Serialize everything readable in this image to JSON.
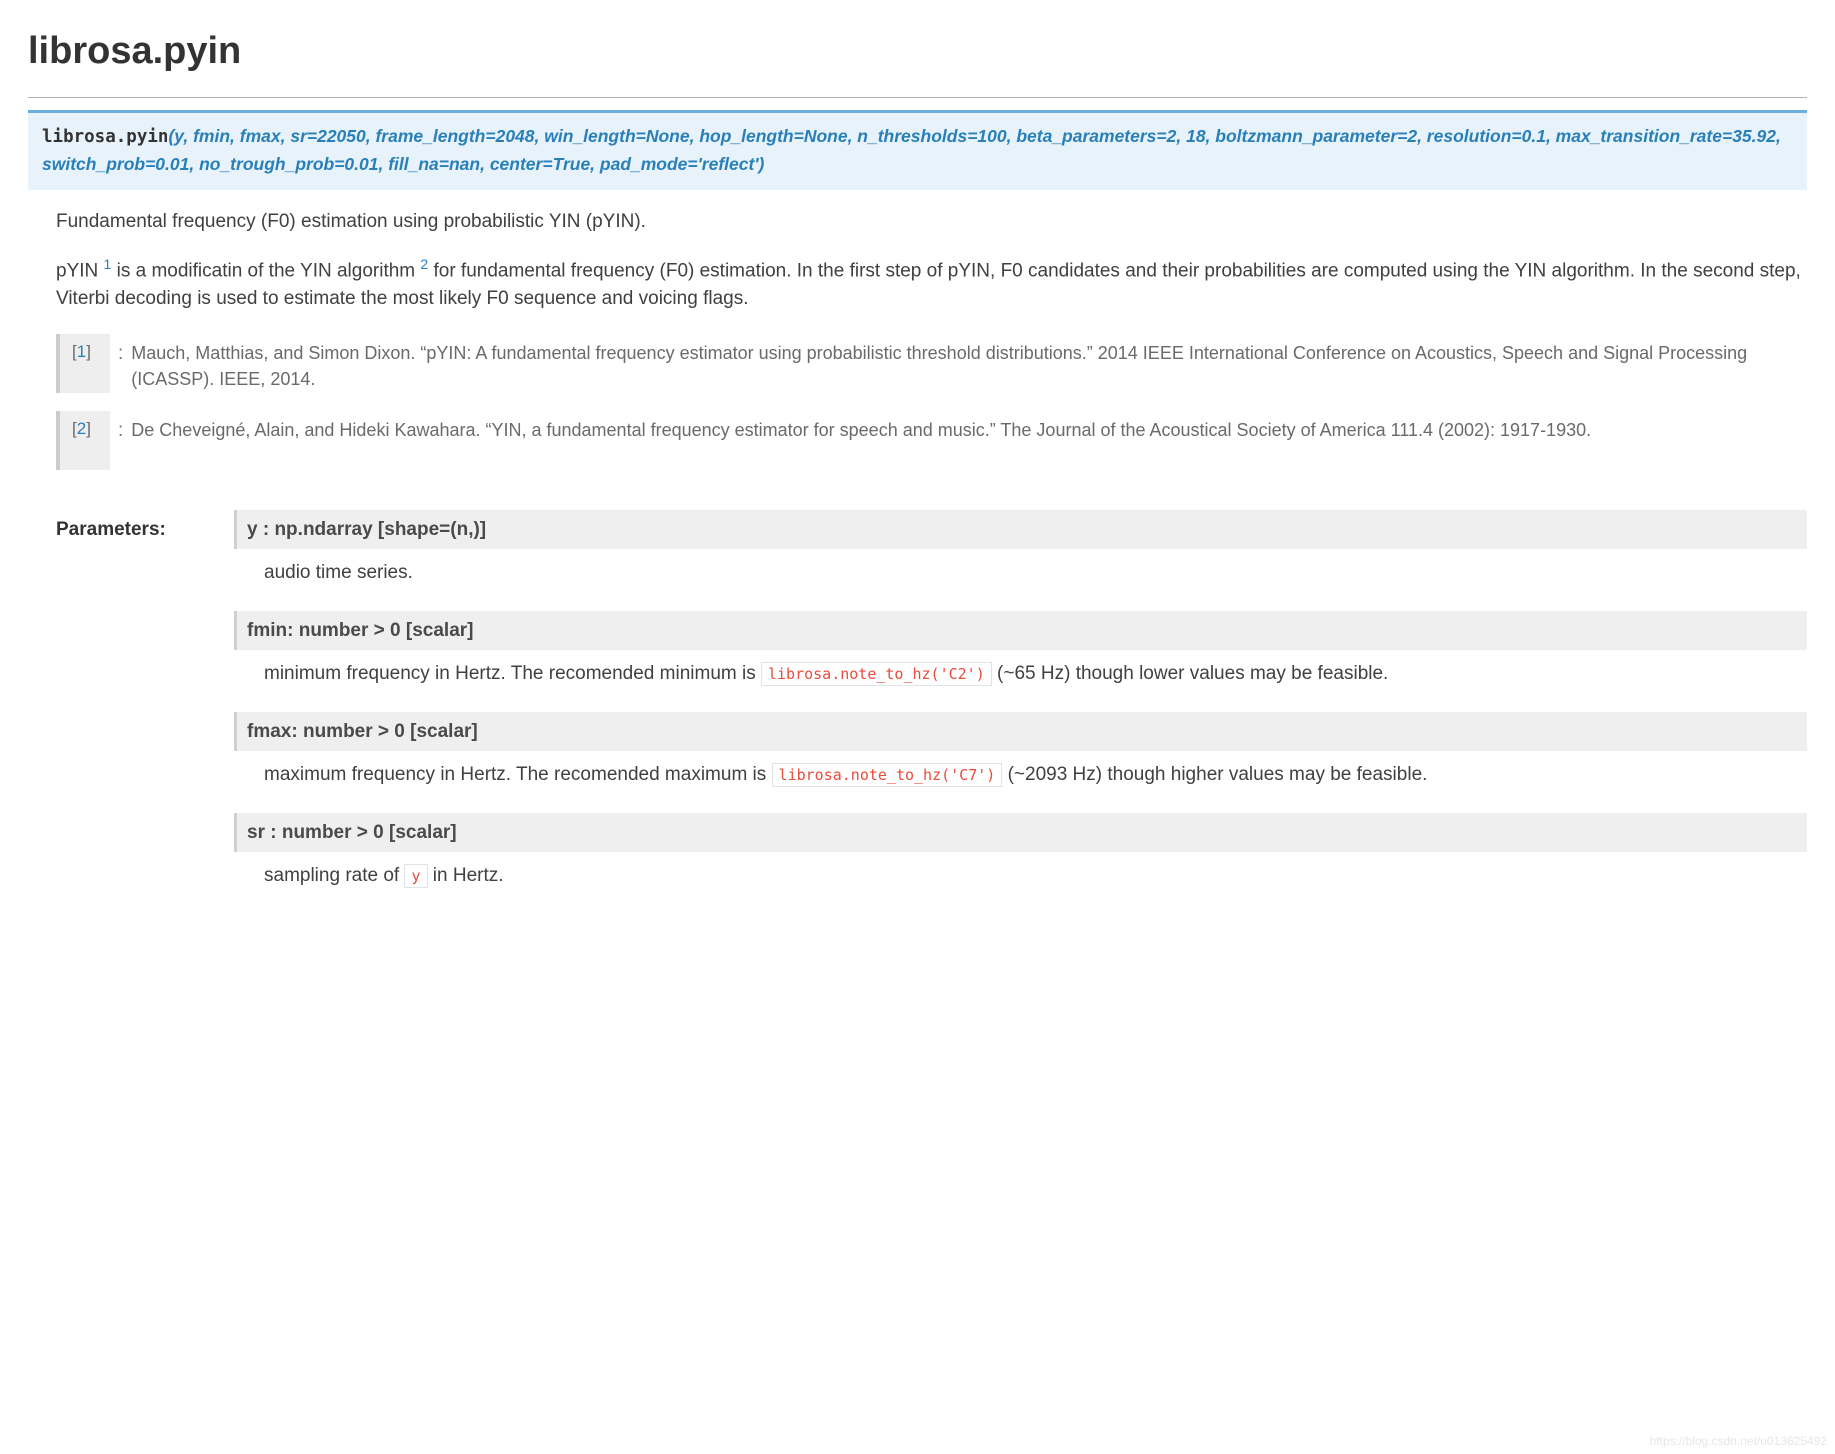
{
  "title": "librosa.pyin",
  "signature": {
    "module": "librosa.",
    "fn": "pyin",
    "args": "y, fmin, fmax, sr=22050, frame_length=2048, win_length=None, hop_length=None, n_thresholds=100, beta_parameters=2, 18, boltzmann_parameter=2, resolution=0.1, max_transition_rate=35.92, switch_prob=0.01, no_trough_prob=0.01, fill_na=nan, center=True, pad_mode='reflect'"
  },
  "lead": "Fundamental frequency (F0) estimation using probabilistic YIN (pYIN).",
  "desc_pre": "pYIN ",
  "desc_ref1": "1",
  "desc_mid1": " is a modificatin of the YIN algorithm ",
  "desc_ref2": "2",
  "desc_mid2": " for fundamental frequency (F0) estimation. In the first step of pYIN, F0 candidates and their probabilities are computed using the YIN algorithm. In the second step, Viterbi decoding is used to estimate the most likely F0 sequence and voicing flags.",
  "citations": [
    {
      "label_open": "[",
      "label_num": "1",
      "label_close": "]",
      "sep": ":",
      "text": "Mauch, Matthias, and Simon Dixon. “pYIN: A fundamental frequency estimator using probabilistic threshold distributions.” 2014 IEEE International Conference on Acoustics, Speech and Signal Processing (ICASSP). IEEE, 2014."
    },
    {
      "label_open": "[",
      "label_num": "2",
      "label_close": "]",
      "sep": ":",
      "text": "De Cheveigné, Alain, and Hideki Kawahara. “YIN, a fundamental frequency estimator for speech and music.” The Journal of the Acoustical Society of America 111.4 (2002): 1917-1930."
    }
  ],
  "params_label": "Parameters:",
  "params": {
    "y": {
      "head": "y : np.ndarray [shape=(n,)]",
      "desc": "audio time series."
    },
    "fmin": {
      "head": "fmin: number > 0 [scalar]",
      "desc_pre": "minimum frequency in Hertz. The recomended minimum is ",
      "code": "librosa.note_to_hz('C2')",
      "desc_post": " (~65 Hz) though lower values may be feasible."
    },
    "fmax": {
      "head": "fmax: number > 0 [scalar]",
      "desc_pre": "maximum frequency in Hertz. The recomended maximum is ",
      "code": "librosa.note_to_hz('C7')",
      "desc_post": " (~2093 Hz) though higher values may be feasible."
    },
    "sr": {
      "head": "sr : number > 0 [scalar]",
      "desc_pre": "sampling rate of ",
      "code": "y",
      "desc_post": " in Hertz."
    }
  },
  "watermark": "https://blog.csdn.net/u013625492"
}
